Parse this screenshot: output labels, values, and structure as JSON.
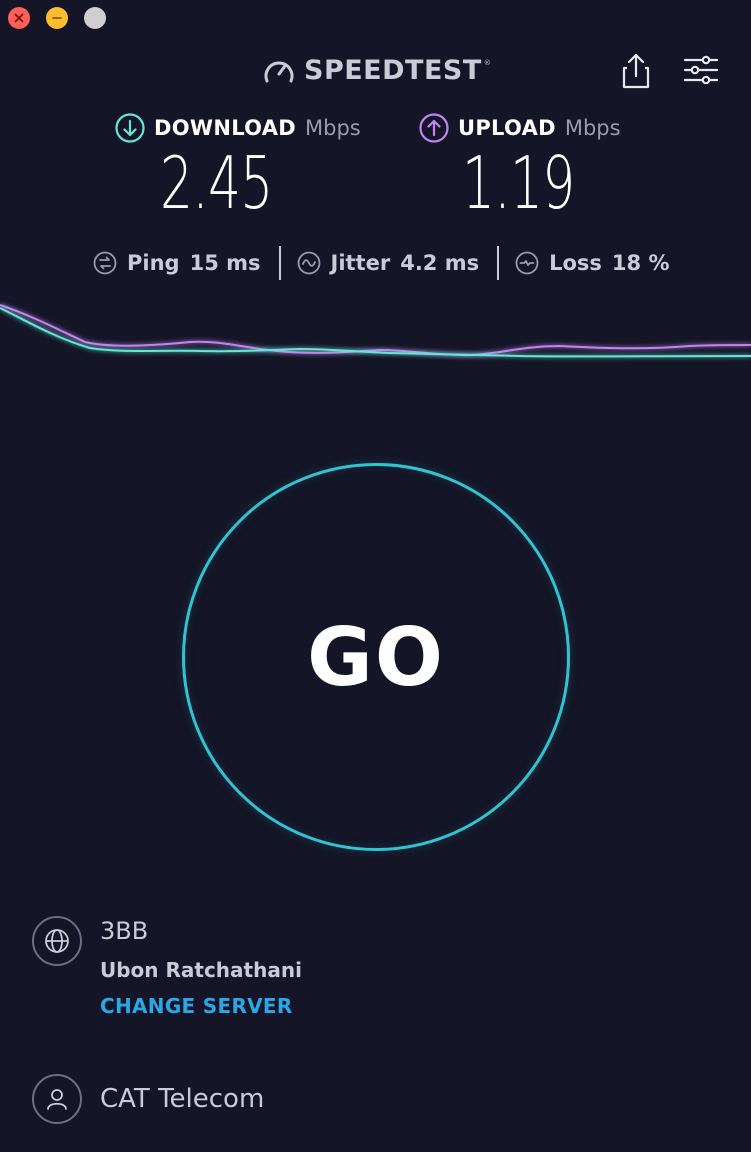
{
  "window": {
    "buttons": [
      "close",
      "minimize",
      "zoom"
    ]
  },
  "header": {
    "logo_text": "SPEEDTEST",
    "logo_mark": "®",
    "share_icon": "share-icon",
    "settings_icon": "sliders-icon"
  },
  "results": {
    "download": {
      "label": "DOWNLOAD",
      "unit": "Mbps",
      "value": "2.45",
      "icon": "arrow-down-circle-icon",
      "color": "#63e6d6"
    },
    "upload": {
      "label": "UPLOAD",
      "unit": "Mbps",
      "value": "1.19",
      "icon": "arrow-up-circle-icon",
      "color": "#c283f0"
    }
  },
  "metrics": {
    "ping": {
      "label": "Ping",
      "value": "15 ms",
      "icon": "ping-icon"
    },
    "jitter": {
      "label": "Jitter",
      "value": "4.2 ms",
      "icon": "jitter-icon"
    },
    "loss": {
      "label": "Loss",
      "value": "18 %",
      "icon": "loss-icon"
    }
  },
  "graph": {
    "download_color": "#63e6d6",
    "upload_color": "#c283f0"
  },
  "go_button": {
    "label": "GO",
    "ring_color": "#2ec4d2"
  },
  "server": {
    "name": "3BB",
    "location": "Ubon Ratchathani",
    "change_label": "CHANGE SERVER",
    "icon": "globe-icon",
    "link_color": "#2aa7e6"
  },
  "provider": {
    "name": "CAT Telecom",
    "icon": "user-icon"
  }
}
